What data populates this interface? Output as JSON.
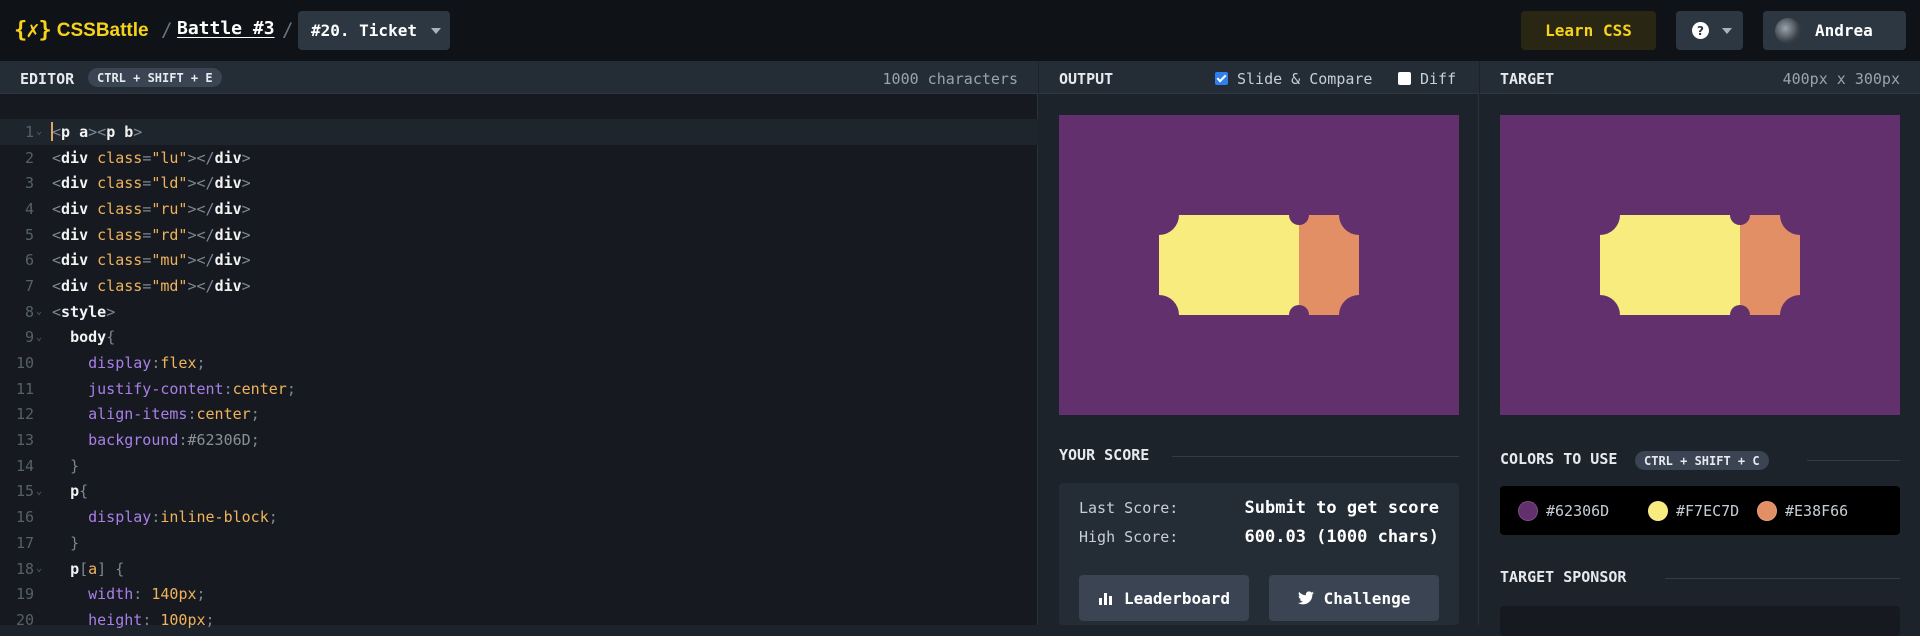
{
  "header": {
    "logo_mark": "{✗}",
    "logo_text": "CSSBattle",
    "separator": "/",
    "battle_link": "Battle #3",
    "level": "#20. Ticket",
    "learn_label": "Learn CSS",
    "help_glyph": "?",
    "user_name": "Andrea"
  },
  "editor": {
    "title": "EDITOR",
    "shortcut": "CTRL + SHIFT + E",
    "char_count": "1000 characters"
  },
  "output": {
    "title": "OUTPUT",
    "slide_label": "Slide & Compare",
    "slide_checked": true,
    "diff_label": "Diff",
    "diff_checked": false,
    "score_title": "YOUR SCORE",
    "last_score_label": "Last Score:",
    "last_score_value": "Submit to get score",
    "high_score_label": "High Score:",
    "high_score_value": "600.03 (1000 chars)",
    "leaderboard_label": "Leaderboard",
    "challenge_label": "Challenge"
  },
  "target": {
    "title": "TARGET",
    "dimensions": "400px x 300px",
    "colors_title": "COLORS TO USE",
    "colors_shortcut": "CTRL + SHIFT + C",
    "colors": [
      {
        "hex": "#62306D",
        "label": "#62306D"
      },
      {
        "hex": "#F7EC7D",
        "label": "#F7EC7D"
      },
      {
        "hex": "#E38F66",
        "label": "#E38F66"
      }
    ],
    "sponsor_title": "TARGET SPONSOR"
  },
  "code_lines": [
    "1",
    "2",
    "3",
    "4",
    "5",
    "6",
    "7",
    "8",
    "9",
    "10",
    "11",
    "12",
    "13",
    "14",
    "15",
    "16",
    "17",
    "18",
    "19",
    "20"
  ],
  "code": {
    "l1": {
      "a": "<",
      "b": "p a",
      "c": "><",
      "d": "p b",
      "e": ">"
    },
    "l2": {
      "tag": "div",
      "attr": "class",
      "val": "\"lu\""
    },
    "l3": {
      "tag": "div",
      "attr": "class",
      "val": "\"ld\""
    },
    "l4": {
      "tag": "div",
      "attr": "class",
      "val": "\"ru\""
    },
    "l5": {
      "tag": "div",
      "attr": "class",
      "val": "\"rd\""
    },
    "l6": {
      "tag": "div",
      "attr": "class",
      "val": "\"mu\""
    },
    "l7": {
      "tag": "div",
      "attr": "class",
      "val": "\"md\""
    },
    "l8": {
      "tag": "style"
    },
    "l9": {
      "sel": "body"
    },
    "l10": {
      "prop": "display",
      "val": "flex"
    },
    "l11": {
      "prop": "justify-content",
      "val": "center"
    },
    "l12": {
      "prop": "align-items",
      "val": "center"
    },
    "l13": {
      "prop": "background",
      "val": "#62306D"
    },
    "l15": {
      "sel": "p"
    },
    "l16": {
      "prop": "display",
      "val": "inline-block"
    },
    "l18": {
      "sel": "p",
      "attr": "a"
    },
    "l19": {
      "prop": "width",
      "num": "140",
      "unit": "px"
    },
    "l20": {
      "prop": "height",
      "num": "100",
      "unit": "px"
    }
  }
}
